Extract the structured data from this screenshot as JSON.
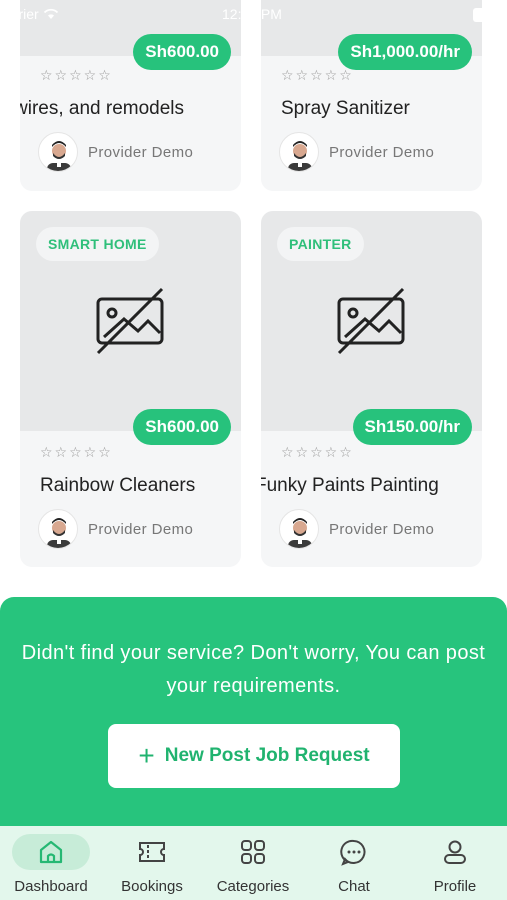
{
  "status": {
    "carrier": "arrier",
    "time": "12:00 PM"
  },
  "cards": [
    {
      "price": "Sh600.00",
      "title": "wires, and remodels",
      "provider": "Provider Demo"
    },
    {
      "price": "Sh1,000.00/hr",
      "title": "Spray Sanitizer",
      "provider": "Provider Demo"
    },
    {
      "category": "SMART HOME",
      "price": "Sh600.00",
      "title": "Rainbow Cleaners",
      "provider": "Provider Demo"
    },
    {
      "category": "PAINTER",
      "price": "Sh150.00/hr",
      "title": "Funky Paints Painting",
      "provider": "Provider Demo"
    }
  ],
  "rating": {
    "stars": "☆☆☆☆☆"
  },
  "banner": {
    "message": "Didn't find your service? Don't worry, You can post your requirements.",
    "button_plus": "+",
    "button_label": "New Post Job Request"
  },
  "tabs": [
    {
      "label": "Dashboard",
      "icon": "home-icon",
      "active": true
    },
    {
      "label": "Bookings",
      "icon": "ticket-icon"
    },
    {
      "label": "Categories",
      "icon": "grid-icon"
    },
    {
      "label": "Chat",
      "icon": "chat-bubble-icon"
    },
    {
      "label": "Profile",
      "icon": "person-icon"
    }
  ],
  "colors": {
    "brand": "#27C47D",
    "tab_bar": "#E3F7EC",
    "active_tab": "#C7ECD8"
  }
}
